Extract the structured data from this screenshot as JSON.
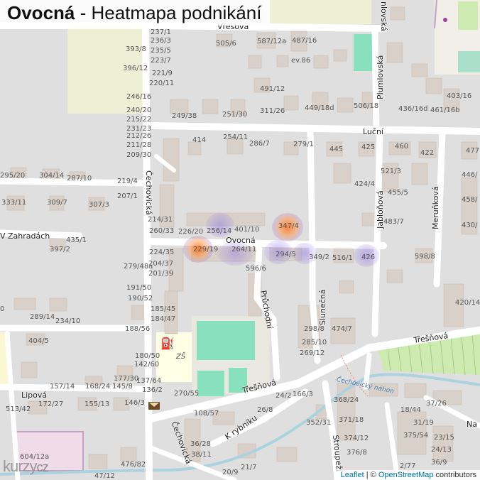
{
  "title": {
    "place": "Ovocná",
    "separator": " - ",
    "subtitle": "Heatmapa podnikání"
  },
  "streets": {
    "vresova": "Vřesová",
    "lucni": "Luční",
    "ovocna": "Ovocná",
    "zahradach": "V Zahradách",
    "cechovicka1": "Čechovická",
    "cechovicka2": "Čechovická",
    "pruchodni": "Průchodní",
    "slunecna": "Slunečná",
    "jablonova": "Jabloňová",
    "merunkova": "Meruňková",
    "plumlovska": "Plumlovská",
    "plumlovska_top": "nlovská",
    "tresnova1": "Třešňová",
    "tresnova2": "Třešňová",
    "lipova": "Lipová",
    "k_rybniku": "K rybníku",
    "stroupezi": "Stroupeží",
    "na": "Na",
    "water": "Čechovický náhon"
  },
  "house_numbers": [
    "237/1",
    "236/3",
    "393/8",
    "235/5",
    "223/7",
    "396/12",
    "221/9",
    "220/11",
    "246/16",
    "240/20",
    "215/22",
    "231/23",
    "212/26",
    "211/28",
    "209/30",
    "219/4",
    "207/1",
    "214/31",
    "260/33",
    "224/35",
    "204/37",
    "201/39",
    "191/50",
    "190/52",
    "185/45",
    "184/47",
    "188/56",
    "180/50",
    "142/60",
    "137/64",
    "136/2",
    "505/6",
    "587/12a",
    "487/16",
    "ev.86",
    "491/12",
    "249/38",
    "251/30",
    "311/26",
    "449/18d",
    "506/18",
    "403/16",
    "436/16d",
    "461/16b",
    "414",
    "254/11",
    "286/7",
    "279/1",
    "445",
    "425",
    "460",
    "422",
    "477",
    "295/20",
    "304/14",
    "287/10",
    "333/11",
    "309/7",
    "307/3",
    "435/1",
    "397/2",
    "279/48a",
    "289/14",
    "234/10",
    "404/5",
    "226/20",
    "256/14",
    "401/10",
    "347/4",
    "229/19",
    "264/11",
    "596/6",
    "294/5",
    "349/2",
    "516/1",
    "426",
    "521/3",
    "424/4",
    "455/5",
    "483/7",
    "446/",
    "458/",
    "430/",
    "598/8",
    "420/14",
    "298/8",
    "285/10",
    "269/12",
    "474/7",
    "270/55",
    "108/57",
    "26/8",
    "24/2",
    "166/3",
    "157/14",
    "168/24",
    "145/8",
    "172/27",
    "155/13",
    "146/3",
    "177/30",
    "513/42",
    "604/12a",
    "476/82",
    "47/12",
    "36/28",
    "38/11",
    "20/9",
    "21/7",
    "368/24",
    "371/18",
    "374/12",
    "376/8",
    "352/31",
    "18/44",
    "31/19",
    "37/26",
    "375/54",
    "23/15",
    "24/13",
    "36/9",
    "2/77",
    "0"
  ],
  "attribution": {
    "leaflet": "Leaflet",
    "sep": " | © ",
    "osm": "OpenStreetMap",
    "contrib": " contributors"
  },
  "logo": {
    "text": "kurzy",
    "tld": "cz"
  },
  "markers": {
    "fuel": "fuel-icon",
    "post": "post-office-icon",
    "school_label": "ZŠ"
  },
  "colors": {
    "road": "#ffffff",
    "building": "#d9d0c9",
    "block": "#e0dfdf",
    "grass": "#cdebb0",
    "pitch": "#88e0be",
    "water": "#aad3df",
    "heat_low": "#8a6fe0",
    "heat_high": "#ff7a2a"
  }
}
